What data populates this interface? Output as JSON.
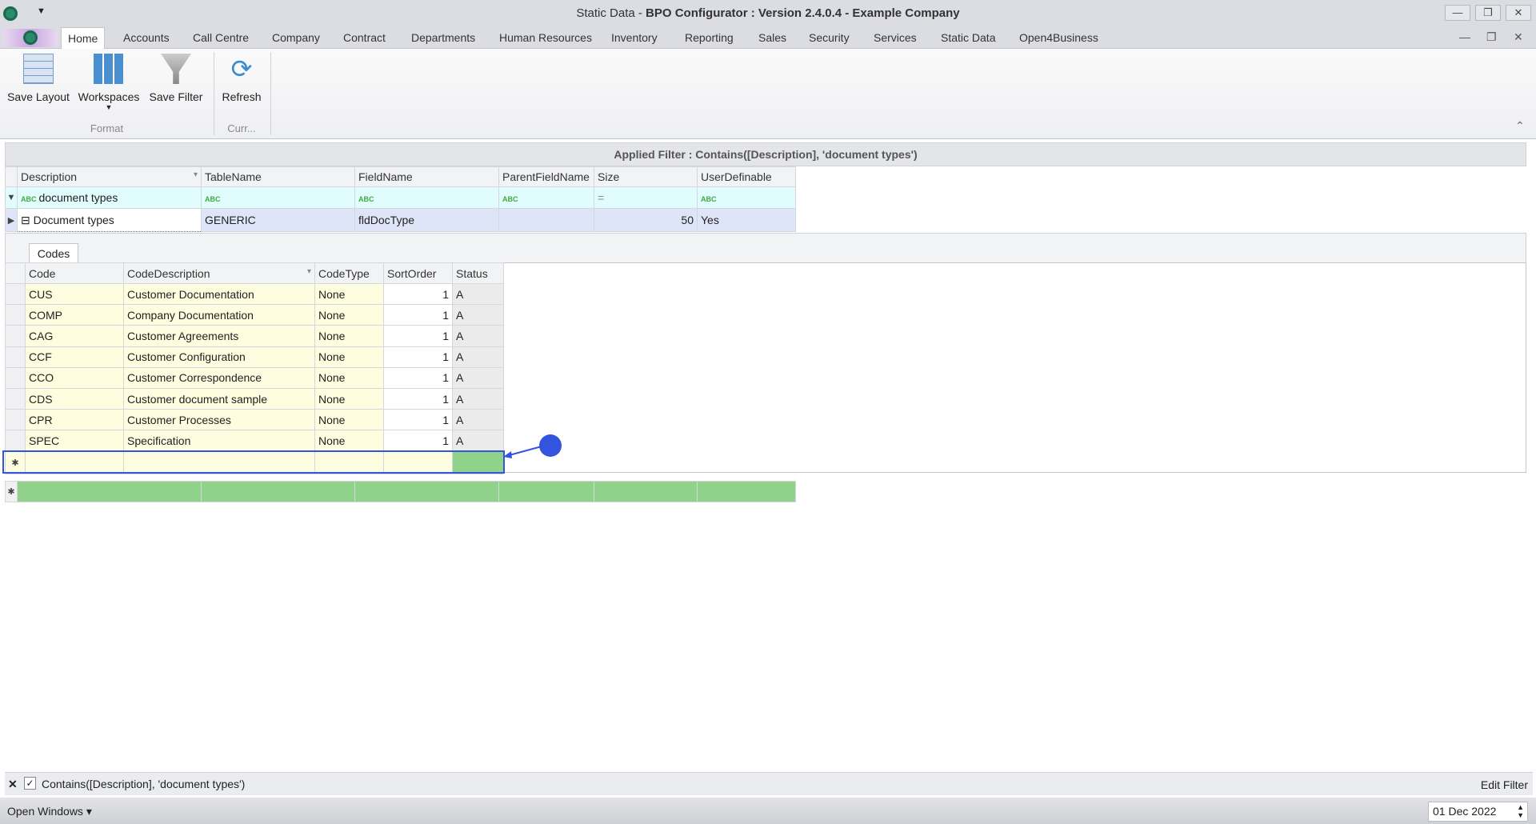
{
  "window": {
    "title_prefix": "Static Data - ",
    "title_bold": "BPO Configurator : Version 2.4.0.4 - Example Company",
    "minimize": "—",
    "restore": "❐",
    "close": "✕"
  },
  "tabs": [
    "Home",
    "Accounts",
    "Call Centre",
    "Company",
    "Contract",
    "Departments",
    "Human Resources",
    "Inventory",
    "Reporting",
    "Sales",
    "Security",
    "Services",
    "Static Data",
    "Open4Business"
  ],
  "ribbon": {
    "save_layout": "Save Layout",
    "workspaces": "Workspaces",
    "save_filter": "Save Filter",
    "refresh": "Refresh",
    "group_format": "Format",
    "group_curr": "Curr..."
  },
  "applied_filter": "Applied Filter : Contains([Description], 'document types')",
  "master": {
    "columns": [
      "Description",
      "TableName",
      "FieldName",
      "ParentFieldName",
      "Size",
      "UserDefinable"
    ],
    "filter_value": "document types",
    "size_filter": "=",
    "row": {
      "description": "Document types",
      "table": "GENERIC",
      "field": "fldDocType",
      "parent": "",
      "size": "50",
      "user_definable": "Yes"
    }
  },
  "detail": {
    "tab": "Codes",
    "columns": [
      "Code",
      "CodeDescription",
      "CodeType",
      "SortOrder",
      "Status"
    ],
    "rows": [
      [
        "CUS",
        "Customer Documentation",
        "None",
        "1",
        "A"
      ],
      [
        "COMP",
        "Company Documentation",
        "None",
        "1",
        "A"
      ],
      [
        "CAG",
        "Customer Agreements",
        "None",
        "1",
        "A"
      ],
      [
        "CCF",
        "Customer Configuration",
        "None",
        "1",
        "A"
      ],
      [
        "CCO",
        "Customer Correspondence",
        "None",
        "1",
        "A"
      ],
      [
        "CDS",
        "Customer document sample",
        "None",
        "1",
        "A"
      ],
      [
        "CPR",
        "Customer Processes",
        "None",
        "1",
        "A"
      ],
      [
        "SPEC",
        "Specification",
        "None",
        "1",
        "A"
      ]
    ]
  },
  "filter_panel": {
    "text": "Contains([Description], 'document types')",
    "edit": "Edit Filter",
    "close": "✕"
  },
  "status": {
    "open_windows": "Open Windows ▾",
    "date": "01 Dec 2022"
  },
  "colors": {
    "accent": "#3355dd",
    "new_row_green": "#90d28a"
  }
}
